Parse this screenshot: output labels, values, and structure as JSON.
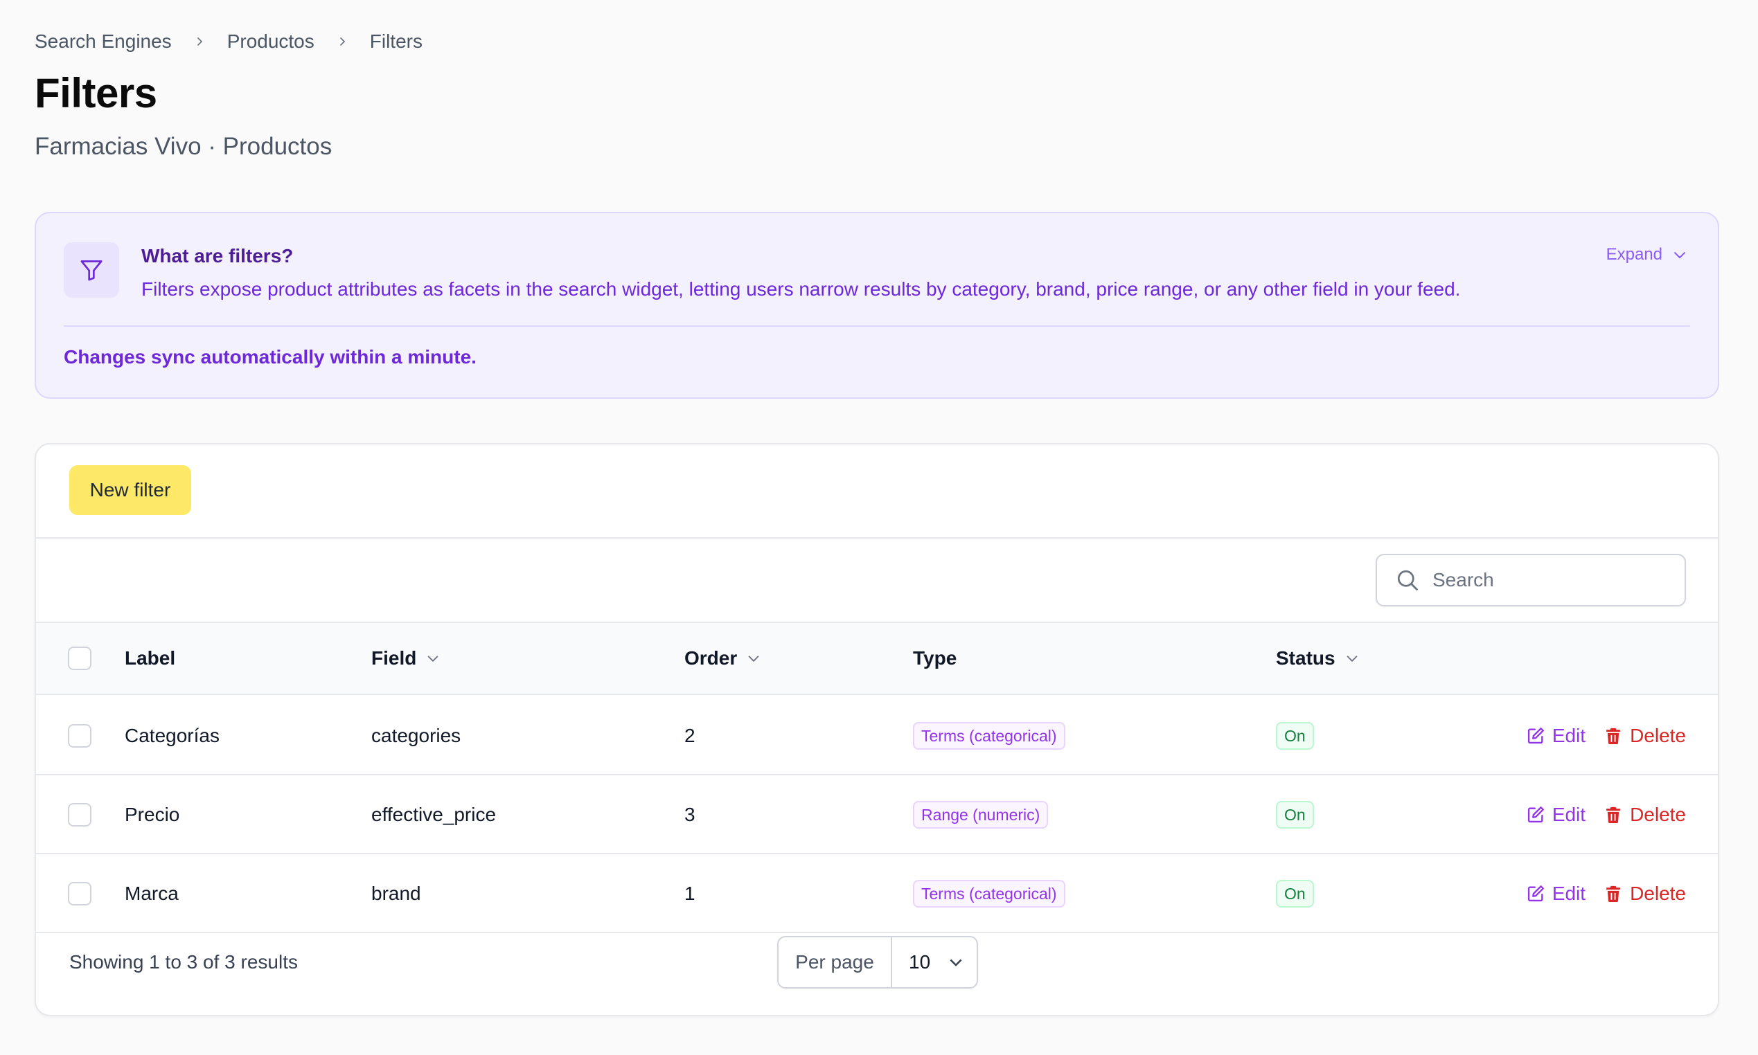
{
  "breadcrumb": [
    "Search Engines",
    "Productos",
    "Filters"
  ],
  "page": {
    "title": "Filters",
    "subtitle": "Farmacias Vivo · Productos"
  },
  "info": {
    "heading": "What are filters?",
    "text": "Filters expose product attributes as facets in the search widget, letting users narrow results by category, brand, price range, or any other field in your feed.",
    "expand_label": "Expand",
    "note": "Changes sync automatically within a minute."
  },
  "toolbar": {
    "new_filter_label": "New filter",
    "search_placeholder": "Search"
  },
  "table": {
    "headers": {
      "label": "Label",
      "field": "Field",
      "order": "Order",
      "type": "Type",
      "status": "Status"
    },
    "rows": [
      {
        "label": "Categorías",
        "field": "categories",
        "order": "2",
        "type": "Terms (categorical)",
        "status": "On",
        "edit": "Edit",
        "delete": "Delete"
      },
      {
        "label": "Precio",
        "field": "effective_price",
        "order": "3",
        "type": "Range (numeric)",
        "status": "On",
        "edit": "Edit",
        "delete": "Delete"
      },
      {
        "label": "Marca",
        "field": "brand",
        "order": "1",
        "type": "Terms (categorical)",
        "status": "On",
        "edit": "Edit",
        "delete": "Delete"
      }
    ]
  },
  "footer": {
    "showing": "Showing 1 to 3 of 3 results",
    "per_page_label": "Per page",
    "per_page_value": "10"
  },
  "colors": {
    "accent_purple": "#9333ea",
    "info_bg": "#f4f1fe",
    "primary_button": "#fde868",
    "danger": "#dc2626",
    "success": "#15803d"
  }
}
